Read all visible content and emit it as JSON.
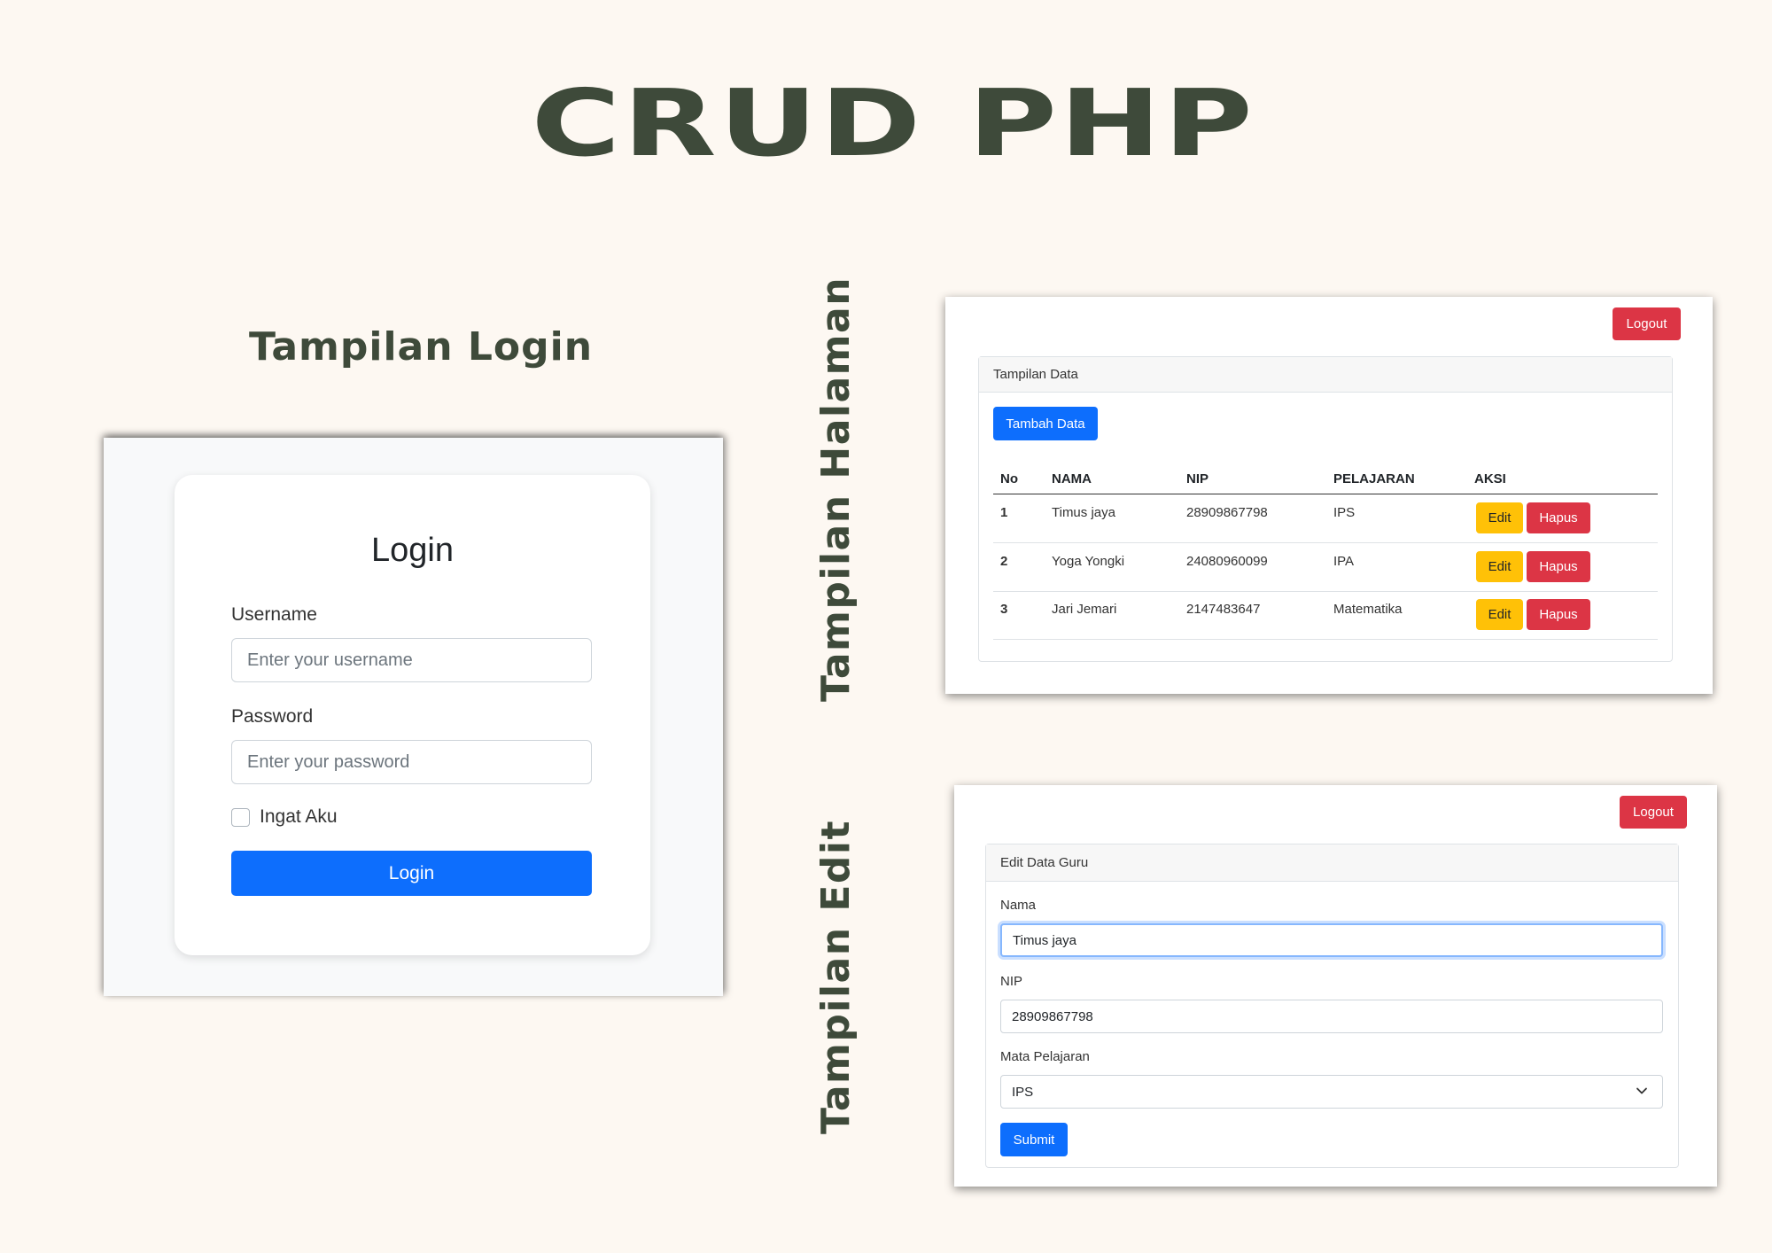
{
  "main_title": "CRUD PHP",
  "labels": {
    "login": "Tampilan Login",
    "halaman": "Tampilan Halaman",
    "edit": "Tampilan Edit"
  },
  "login_screen": {
    "title": "Login",
    "username_label": "Username",
    "username_placeholder": "Enter your username",
    "password_label": "Password",
    "password_placeholder": "Enter your password",
    "remember_label": "Ingat Aku",
    "submit_label": "Login"
  },
  "data_screen": {
    "logout_label": "Logout",
    "card_title": "Tampilan Data",
    "add_button": "Tambah Data",
    "columns": [
      "No",
      "NAMA",
      "NIP",
      "PELAJARAN",
      "AKSI"
    ],
    "rows": [
      {
        "no": "1",
        "nama": "Timus jaya",
        "nip": "28909867798",
        "pelajaran": "IPS"
      },
      {
        "no": "2",
        "nama": "Yoga Yongki",
        "nip": "24080960099",
        "pelajaran": "IPA"
      },
      {
        "no": "3",
        "nama": "Jari Jemari",
        "nip": "2147483647",
        "pelajaran": "Matematika"
      }
    ],
    "edit_label": "Edit",
    "delete_label": "Hapus"
  },
  "edit_screen": {
    "logout_label": "Logout",
    "card_title": "Edit Data Guru",
    "nama_label": "Nama",
    "nama_value": "Timus jaya",
    "nip_label": "NIP",
    "nip_value": "28909867798",
    "mapel_label": "Mata Pelajaran",
    "mapel_value": "IPS",
    "submit_label": "Submit"
  },
  "colors": {
    "background": "#fdf8f2",
    "heading": "#3e4a3a",
    "primary": "#0d6efd",
    "danger": "#dc3545",
    "warning": "#ffc107"
  }
}
